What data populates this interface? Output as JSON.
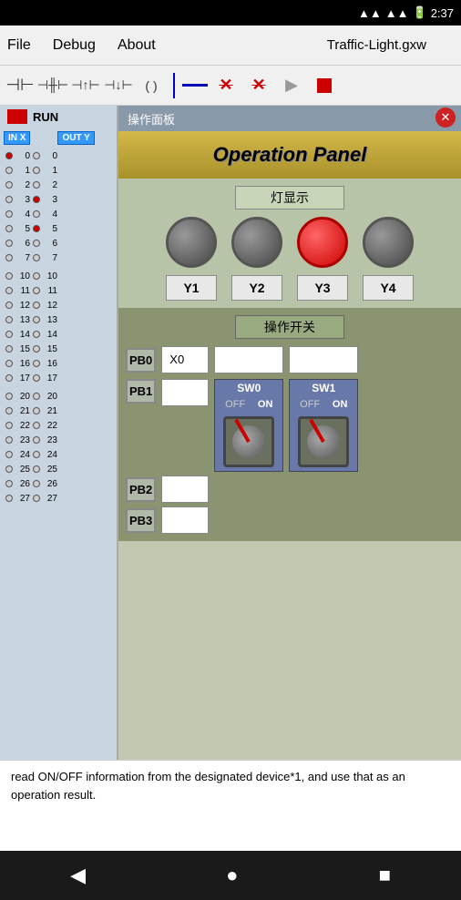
{
  "statusBar": {
    "time": "2:37",
    "wifiIcon": "📶",
    "signalIcon": "📶",
    "batteryIcon": "🔋"
  },
  "menuBar": {
    "file": "File",
    "debug": "Debug",
    "about": "About",
    "filename": "Traffic-Light.gxw"
  },
  "toolbar": {
    "icons": [
      "contact-no",
      "contact-nc",
      "contact-p",
      "contact-n",
      "coil",
      "separator",
      "line",
      "x1",
      "x2",
      "play",
      "stop"
    ]
  },
  "leftPanel": {
    "title": "操作面板",
    "runLabel": "RUN",
    "inxLabel": "IN X",
    "outyLabel": "OUT Y",
    "rows0": [
      {
        "num": "0",
        "leftActive": true,
        "rightActive": false
      },
      {
        "num": "1",
        "leftActive": false,
        "rightActive": false
      },
      {
        "num": "2",
        "leftActive": false,
        "rightActive": false
      },
      {
        "num": "3",
        "leftActive": false,
        "rightActive": true
      },
      {
        "num": "4",
        "leftActive": false,
        "rightActive": false
      },
      {
        "num": "5",
        "leftActive": false,
        "rightActive": true
      },
      {
        "num": "6",
        "leftActive": false,
        "rightActive": false
      },
      {
        "num": "7",
        "leftActive": false,
        "rightActive": false
      }
    ],
    "rows1": [
      {
        "num": "10",
        "leftActive": false,
        "rightActive": false
      },
      {
        "num": "11",
        "leftActive": false,
        "rightActive": false
      },
      {
        "num": "12",
        "leftActive": false,
        "rightActive": false
      },
      {
        "num": "13",
        "leftActive": false,
        "rightActive": false
      },
      {
        "num": "14",
        "leftActive": false,
        "rightActive": false
      },
      {
        "num": "15",
        "leftActive": false,
        "rightActive": false
      },
      {
        "num": "16",
        "leftActive": false,
        "rightActive": false
      },
      {
        "num": "17",
        "leftActive": false,
        "rightActive": false
      }
    ],
    "rows2": [
      {
        "num": "20",
        "leftActive": false,
        "rightActive": false
      },
      {
        "num": "21",
        "leftActive": false,
        "rightActive": false
      },
      {
        "num": "22",
        "leftActive": false,
        "rightActive": false
      },
      {
        "num": "23",
        "leftActive": false,
        "rightActive": false
      },
      {
        "num": "24",
        "leftActive": false,
        "rightActive": false
      },
      {
        "num": "25",
        "leftActive": false,
        "rightActive": false
      },
      {
        "num": "26",
        "leftActive": false,
        "rightActive": false
      },
      {
        "num": "27",
        "leftActive": false,
        "rightActive": false
      }
    ]
  },
  "operationPanel": {
    "title": "Operation Panel",
    "lightSection": {
      "label": "灯显示",
      "lights": [
        {
          "id": "Y1",
          "active": false
        },
        {
          "id": "Y2",
          "active": false
        },
        {
          "id": "Y3",
          "active": true
        },
        {
          "id": "Y4",
          "active": false
        }
      ]
    },
    "switchSection": {
      "label": "操作开关",
      "buttons": [
        {
          "id": "PB0",
          "inputLabel": "X0"
        },
        {
          "id": "PB1",
          "inputLabel": ""
        },
        {
          "id": "PB2",
          "inputLabel": ""
        },
        {
          "id": "PB3",
          "inputLabel": ""
        }
      ],
      "sw0": {
        "label": "SW0",
        "off": "OFF",
        "on": "ON"
      },
      "sw1": {
        "label": "SW1",
        "off": "OFF",
        "on": "ON"
      }
    }
  },
  "textArea": {
    "text": "read ON/OFF information from the designated device*1, and use that as an operation result."
  },
  "navBar": {
    "back": "◀",
    "home": "●",
    "recent": "■"
  }
}
